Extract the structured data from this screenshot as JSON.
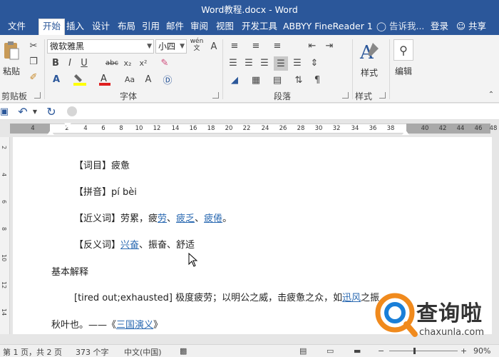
{
  "window": {
    "title": "Word教程.docx - Word"
  },
  "tabs": {
    "file": "文件",
    "home": "开始",
    "insert": "插入",
    "design": "设计",
    "layout": "布局",
    "references": "引用",
    "mailings": "邮件",
    "review": "审阅",
    "view": "视图",
    "developer": "开发工具",
    "abbyy": "ABBYY FineReader 1"
  },
  "tell_me": "告诉我...",
  "account": {
    "login": "登录",
    "share": "共享"
  },
  "ribbon": {
    "paste_label": "粘贴",
    "font_name": "微软雅黑",
    "font_size": "小四",
    "wen": "wén",
    "styles_label": "样式",
    "editing_label": "编辑",
    "groups": {
      "clipboard": "剪贴板",
      "font": "字体",
      "paragraph": "段落",
      "styles": "样式"
    }
  },
  "ruler": {
    "left_ticks": [
      "4",
      "2"
    ],
    "ticks": [
      "2",
      "4",
      "6",
      "8",
      "10",
      "12",
      "14",
      "16",
      "18",
      "20",
      "22",
      "24",
      "26",
      "28",
      "30",
      "32",
      "34",
      "36",
      "38"
    ],
    "right_ticks": [
      "40",
      "42",
      "44",
      "46",
      "48"
    ],
    "vticks": [
      "2",
      "4",
      "6",
      "8",
      "10",
      "12",
      "14"
    ]
  },
  "document": {
    "l1": "【词目】疲惫",
    "l2": "【拼音】pí bèi",
    "l3_pre": "【近义词】劳累，疲",
    "l3_link1": "劳",
    "l3_sep1": "、",
    "l3_link2": "疲乏",
    "l3_sep2": "、",
    "l3_link3": "疲倦",
    "l3_end": "。",
    "l4_pre": "【反义词】",
    "l4_link1": "兴奋",
    "l4_rest": "、振奋、舒适",
    "l5": "基本解释",
    "l6_pre": "[tired out;exhausted] 极度疲劳；以明公之威，击疲惫之众，如",
    "l6_link": "迅风",
    "l6_end": "之振",
    "l7_pre": "秋叶也。——《",
    "l7_link": "三国演义",
    "l7_end": "》"
  },
  "status": {
    "page": "第 1 页，共 2 页",
    "words": "373 个字",
    "lang": "中文(中国)",
    "zoom": "90%"
  },
  "watermark": {
    "brand": "查询啦",
    "domain": "chaxunla.com"
  },
  "colors": {
    "accent": "#2b579a",
    "link": "#2b6ab2",
    "logo_orange": "#f08a1d",
    "logo_blue": "#1a7fd8"
  }
}
